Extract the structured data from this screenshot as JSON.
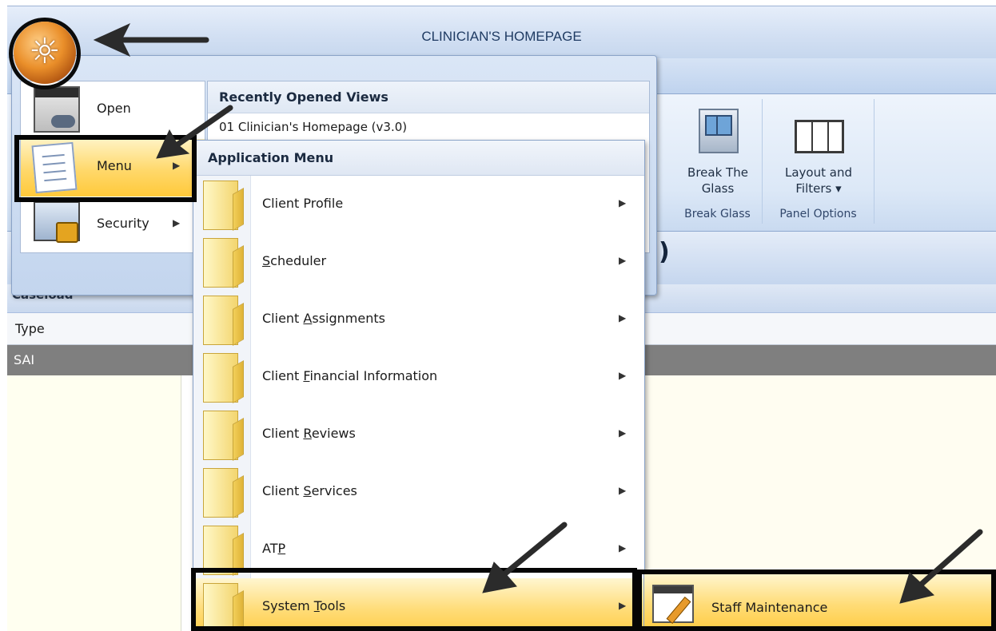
{
  "window": {
    "title": "CLINICIAN'S HOMEPAGE"
  },
  "ribbon": {
    "break_glass": {
      "button_line1": "Break The",
      "button_line2": "Glass",
      "group": "Break Glass"
    },
    "panel_options": {
      "button_line1": "Layout and",
      "button_line2": "Filters ▾",
      "group": "Panel Options"
    }
  },
  "section": {
    "partial_heading": ")",
    "caseload_label": "Caseload"
  },
  "grid": {
    "column": "Type",
    "selected_row": "SAI"
  },
  "app_menu": {
    "left_items": [
      {
        "label": "Open",
        "has_submenu": false
      },
      {
        "label": "Menu",
        "has_submenu": true,
        "selected": true
      },
      {
        "label": "Security",
        "has_submenu": true
      }
    ],
    "recent": {
      "header": "Recently Opened Views",
      "item": "01 Clinician's Homepage (v3.0)"
    }
  },
  "sub_menu": {
    "header": "Application Menu",
    "items": [
      {
        "label": "Client Profile",
        "mnemonic": ""
      },
      {
        "label": "Scheduler",
        "pre": "",
        "key": "S",
        "post": "cheduler"
      },
      {
        "label": "Client Assignments",
        "pre": "Client ",
        "key": "A",
        "post": "ssignments"
      },
      {
        "label": "Client Financial Information",
        "pre": "Client ",
        "key": "F",
        "post": "inancial Information"
      },
      {
        "label": "Client Reviews",
        "pre": "Client ",
        "key": "R",
        "post": "eviews"
      },
      {
        "label": "Client Services",
        "pre": "Client ",
        "key": "S",
        "post": "ervices"
      },
      {
        "label": "ATP",
        "pre": "AT",
        "key": "P",
        "post": ""
      },
      {
        "label": "System Tools",
        "pre": "System ",
        "key": "T",
        "post": "ools",
        "selected": true
      }
    ]
  },
  "flyout": {
    "item": "Staff Maintenance"
  },
  "colors": {
    "highlight": "#ffd86a",
    "annotation": "#050505",
    "orb": "#ea8f2a"
  }
}
